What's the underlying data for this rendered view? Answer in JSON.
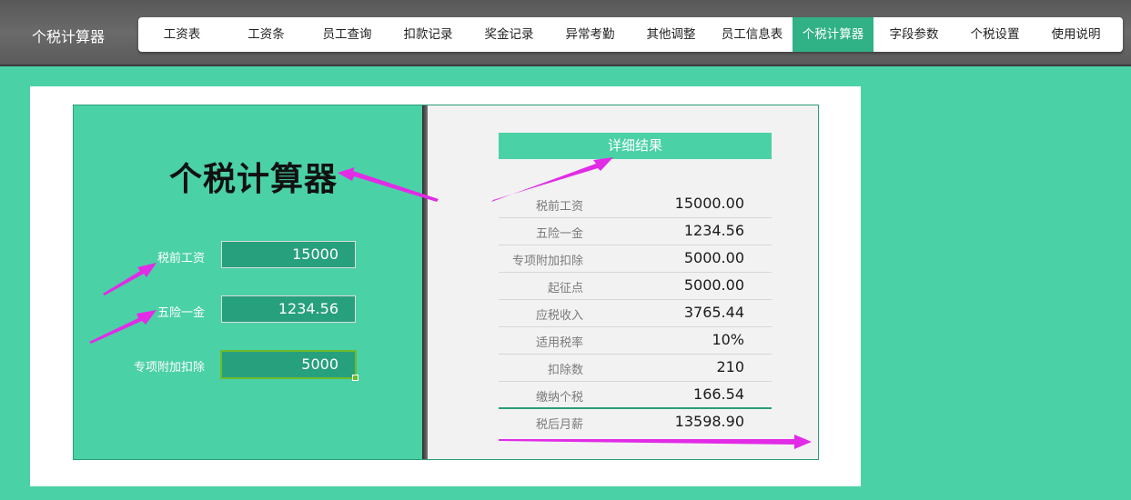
{
  "app": {
    "title": "个税计算器"
  },
  "tabs": [
    {
      "label": "工资表",
      "active": false
    },
    {
      "label": "工资条",
      "active": false
    },
    {
      "label": "员工查询",
      "active": false
    },
    {
      "label": "扣款记录",
      "active": false
    },
    {
      "label": "奖金记录",
      "active": false
    },
    {
      "label": "异常考勤",
      "active": false
    },
    {
      "label": "其他调整",
      "active": false
    },
    {
      "label": "员工信息表",
      "active": false
    },
    {
      "label": "个税计算器",
      "active": true
    },
    {
      "label": "字段参数",
      "active": false
    },
    {
      "label": "个税设置",
      "active": false
    },
    {
      "label": "使用说明",
      "active": false
    }
  ],
  "calculator": {
    "title": "个税计算器",
    "inputs": [
      {
        "label": "税前工资",
        "value": "15000"
      },
      {
        "label": "五险一金",
        "value": "1234.56"
      },
      {
        "label": "专项附加扣除",
        "value": "5000"
      }
    ]
  },
  "results": {
    "header": "详细结果",
    "rows": [
      {
        "label": "税前工资",
        "value": "15000.00"
      },
      {
        "label": "五险一金",
        "value": "1234.56"
      },
      {
        "label": "专项附加扣除",
        "value": "5000.00"
      },
      {
        "label": "起征点",
        "value": "5000.00"
      },
      {
        "label": "应税收入",
        "value": "3765.44"
      },
      {
        "label": "适用税率",
        "value": "10%"
      },
      {
        "label": "扣除数",
        "value": "210"
      },
      {
        "label": "缴纳个税",
        "value": "166.54"
      },
      {
        "label": "税后月薪",
        "value": "13598.90"
      }
    ]
  },
  "colors": {
    "background": "#4bd1a6",
    "active_tab": "#30b186",
    "input_fill": "#27a07d",
    "annotation_arrow": "#e22be6"
  }
}
